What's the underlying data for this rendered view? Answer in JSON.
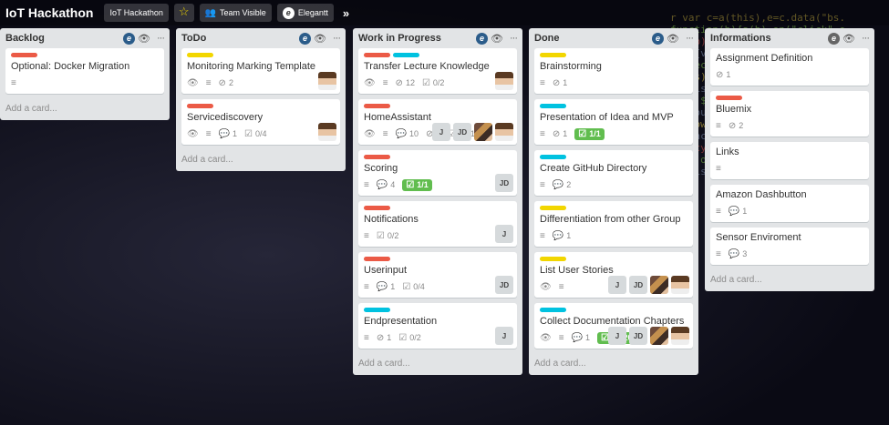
{
  "topbar": {
    "board_title": "IoT Hackathon",
    "org_button": "IoT Hackathon",
    "visibility_button": "Team Visible",
    "powerup_button": "Elegantt"
  },
  "lists": [
    {
      "title": "Backlog",
      "add_card": "Add a card...",
      "cards": [
        {
          "labels": [
            "#eb5a46"
          ],
          "title": "Optional: Docker Migration",
          "badges": {
            "description": true
          }
        }
      ]
    },
    {
      "title": "ToDo",
      "add_card": "Add a card...",
      "cards": [
        {
          "labels": [
            "#f2d600"
          ],
          "title": "Monitoring Marking Template",
          "badges": {
            "watch": true,
            "description": true,
            "attachments": "2"
          },
          "members": [
            "photo"
          ]
        },
        {
          "labels": [
            "#eb5a46"
          ],
          "title": "Servicediscovery",
          "badges": {
            "watch": true,
            "description": true,
            "comments": "1",
            "checklist": "0/4"
          },
          "members": [
            "photo"
          ]
        }
      ]
    },
    {
      "title": "Work in Progress",
      "add_card": "Add a card...",
      "cards": [
        {
          "labels": [
            "#eb5a46",
            "#00c2e0"
          ],
          "title": "Transfer Lecture Knowledge",
          "badges": {
            "watch": true,
            "description": true,
            "attachments": "12",
            "checklist": "0/2"
          },
          "members": [
            "photo"
          ]
        },
        {
          "labels": [
            "#eb5a46"
          ],
          "title": "HomeAssistant",
          "badges": {
            "watch": true,
            "description": true,
            "comments": "10",
            "attachments": "2",
            "checklist": "10/17"
          },
          "members": [
            "J",
            "JD",
            "photo2",
            "photo"
          ]
        },
        {
          "labels": [
            "#eb5a46"
          ],
          "title": "Scoring",
          "badges": {
            "description": true,
            "comments": "4",
            "checklist_done": "1/1"
          },
          "members": [
            "JD"
          ]
        },
        {
          "labels": [
            "#eb5a46"
          ],
          "title": "Notifications",
          "badges": {
            "description": true,
            "checklist": "0/2"
          },
          "members": [
            "J"
          ]
        },
        {
          "labels": [
            "#eb5a46"
          ],
          "title": "Userinput",
          "badges": {
            "description": true,
            "comments": "1",
            "checklist": "0/4"
          },
          "members": [
            "JD"
          ]
        },
        {
          "labels": [
            "#00c2e0"
          ],
          "title": "Endpresentation",
          "badges": {
            "description": true,
            "attachments": "1",
            "checklist": "0/2"
          },
          "members": [
            "J"
          ]
        }
      ]
    },
    {
      "title": "Done",
      "add_card": "Add a card...",
      "cards": [
        {
          "labels": [
            "#f2d600"
          ],
          "title": "Brainstorming",
          "badges": {
            "description": true,
            "attachments": "1"
          }
        },
        {
          "labels": [
            "#00c2e0"
          ],
          "title": "Presentation of Idea and MVP",
          "badges": {
            "description": true,
            "attachments": "1",
            "checklist_done": "1/1"
          }
        },
        {
          "labels": [
            "#00c2e0"
          ],
          "title": "Create GitHub Directory",
          "badges": {
            "description": true,
            "comments": "2"
          }
        },
        {
          "labels": [
            "#f2d600"
          ],
          "title": "Differentiation from other Group",
          "badges": {
            "description": true,
            "comments": "1"
          }
        },
        {
          "labels": [
            "#f2d600"
          ],
          "title": "List User Stories",
          "badges": {
            "watch": true,
            "description": true
          },
          "members": [
            "J",
            "JD",
            "photo2",
            "photo"
          ]
        },
        {
          "labels": [
            "#00c2e0"
          ],
          "title": "Collect Documentation Chapters",
          "badges": {
            "watch": true,
            "description": true,
            "comments": "1",
            "checklist_done": "20/20"
          },
          "members": [
            "J",
            "JD",
            "photo2",
            "photo"
          ]
        }
      ]
    },
    {
      "title": "Informations",
      "add_card": "Add a card...",
      "cards": [
        {
          "labels": [],
          "title": "Assignment Definition",
          "badges": {
            "attachments": "1"
          }
        },
        {
          "labels": [
            "#eb5a46"
          ],
          "title": "Bluemix",
          "badges": {
            "description": true,
            "attachments": "2"
          }
        },
        {
          "labels": [],
          "title": "Links",
          "badges": {
            "description": true
          }
        },
        {
          "labels": [],
          "title": "Amazon Dashbutton",
          "badges": {
            "description": true,
            "comments": "1"
          }
        },
        {
          "labels": [],
          "title": "Sensor Enviroment",
          "badges": {
            "description": true,
            "comments": "3"
          }
        }
      ]
    }
  ]
}
